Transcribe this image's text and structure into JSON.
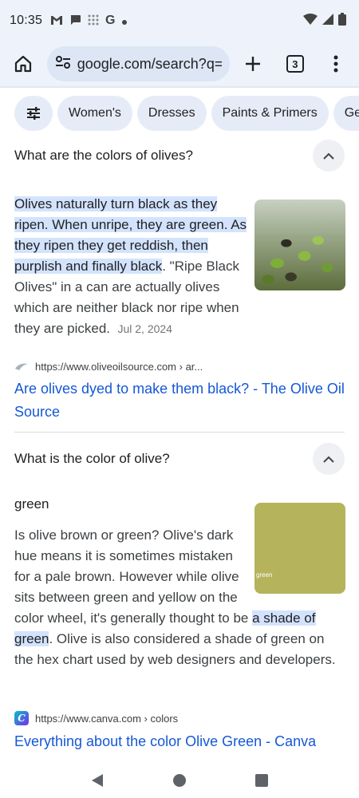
{
  "status": {
    "time": "10:35",
    "left_icons": [
      "gmail-icon",
      "chat-icon",
      "grid-icon",
      "google-icon",
      "dot-icon"
    ],
    "right_icons": [
      "wifi-icon",
      "signal-icon",
      "battery-icon"
    ]
  },
  "toolbar": {
    "url": "google.com/search?q=o",
    "tab_count": "3"
  },
  "chips": [
    "Women's",
    "Dresses",
    "Paints & Primers",
    "Get"
  ],
  "faq1": {
    "question": "What are the colors of olives?",
    "answer_highlight": "Olives naturally turn black as they ripen. When unripe, they are green. As they ripen they get reddish, then purplish and finally black",
    "answer_rest": ". \"Ripe Black Olives\" in a can are actually olives which are neither black nor ripe when they are picked.",
    "date": "Jul 2, 2024",
    "source_url": "https://www.oliveoilsource.com › ar...",
    "link_title": "Are olives dyed to make them black? - The Olive Oil Source"
  },
  "faq2": {
    "question": "What is the color of olive?",
    "short_answer": "green",
    "answer_part1": "Is olive brown or green? Olive's dark hue means it is sometimes mistaken for a pale brown. However while olive sits between green and yellow on the color wheel, it's generally thought to be ",
    "answer_highlight": "a shade of green",
    "answer_part2": ". Olive is also considered a shade of green on the hex chart used by web designers and developers.",
    "swatch_label": "green",
    "swatch_color": "#b5b35c",
    "source_url": "https://www.canva.com › colors",
    "link_title": "Everything about the color Olive Green - Canva"
  },
  "colors": {
    "link": "#1558d6",
    "highlight": "#d3e3fd",
    "toolbar_bg": "#eef3fb"
  }
}
